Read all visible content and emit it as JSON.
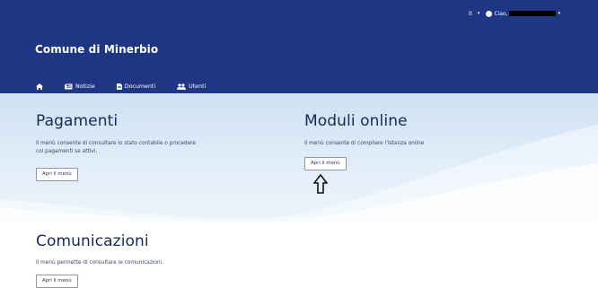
{
  "header": {
    "language": "it",
    "greeting": "Ciao,",
    "site_title": "Comune di Minerbio"
  },
  "nav": {
    "items": [
      {
        "label": "Notizie"
      },
      {
        "label": "Documenti"
      },
      {
        "label": "Utenti"
      }
    ]
  },
  "sections": {
    "pagamenti": {
      "title": "Pagamenti",
      "desc_line1": "Il menù consente di consultare lo stato contabile o procedere",
      "desc_line2": "coi pagamenti se attivi.",
      "button": "Apri il menù"
    },
    "moduli": {
      "title": "Moduli online",
      "desc": "Il menù consente di compilare l’istanza online",
      "button": "Apri il menù"
    },
    "comunicazioni": {
      "title": "Comunicazioni",
      "desc": "Il menù permette di consultare le comunicazioni.",
      "button": "Apri il menù"
    }
  },
  "colors": {
    "header_bg": "#1e3683",
    "hero_bg": "#dce9f6",
    "title": "#172a57"
  }
}
